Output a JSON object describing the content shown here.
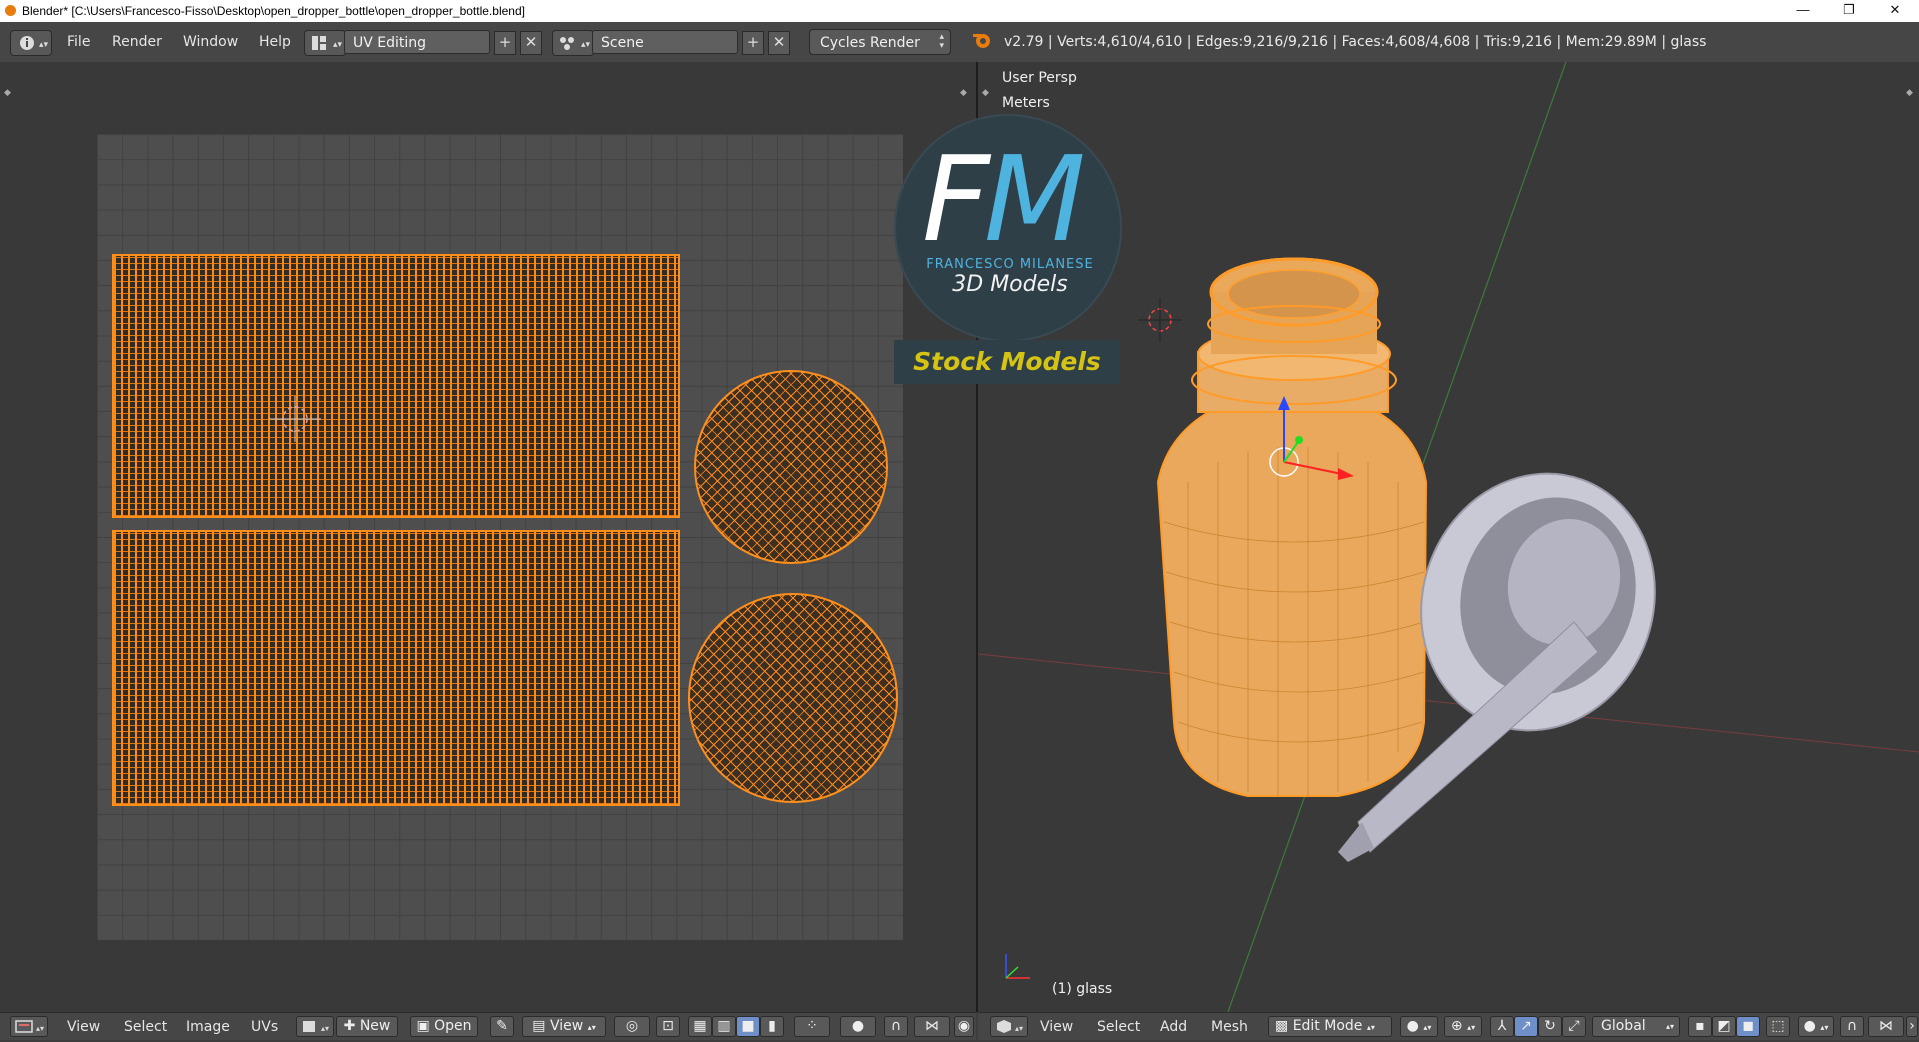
{
  "window": {
    "title": "Blender* [C:\\Users\\Francesco-Fisso\\Desktop\\open_dropper_bottle\\open_dropper_bottle.blend]",
    "minimize": "—",
    "maximize": "❐",
    "close": "✕"
  },
  "topbar": {
    "menus": [
      "File",
      "Render",
      "Window",
      "Help"
    ],
    "layout": "UV Editing",
    "scene": "Scene",
    "engine": "Cycles Render",
    "stats": "v2.79 | Verts:4,610/4,610 | Edges:9,216/9,216 | Faces:4,608/4,608 | Tris:9,216 | Mem:29.89M | glass"
  },
  "uv_editor": {
    "menus": [
      "View",
      "Select",
      "Image",
      "UVs"
    ],
    "new_label": "New",
    "open_label": "Open",
    "view_label": "View"
  },
  "viewport": {
    "perspective": "User Persp",
    "units": "Meters",
    "object_label": "(1) glass",
    "menus": [
      "View",
      "Select",
      "Add",
      "Mesh"
    ],
    "mode": "Edit Mode",
    "orientation": "Global"
  },
  "watermark": {
    "initial_f": "F",
    "initial_m": "M",
    "name": "FRANCESCO MILANESE",
    "tagline": "3D Models",
    "banner": "Stock Models"
  },
  "colors": {
    "uv_orange": "#ff8a16",
    "mesh_orange": "#f0a040",
    "watermark_blue": "#4fb3e0",
    "banner_yellow": "#d6c414",
    "header_gray": "#464646"
  }
}
